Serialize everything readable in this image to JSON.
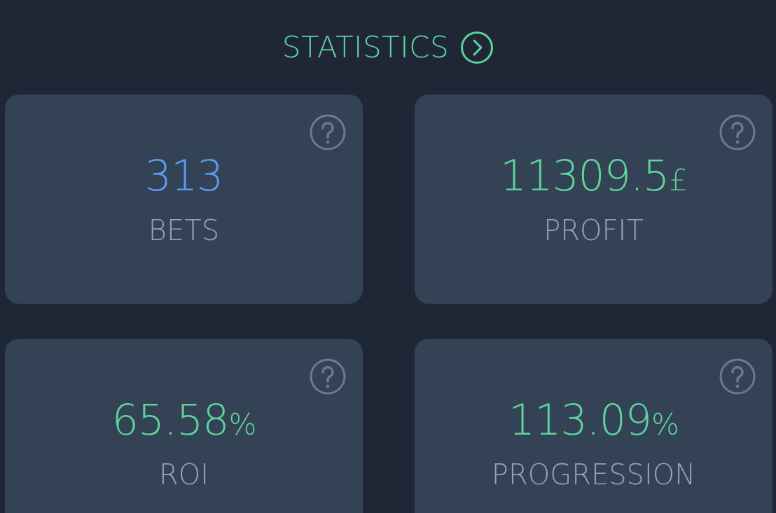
{
  "header": {
    "title": "STATISTICS"
  },
  "cards": [
    {
      "value": "313",
      "label": "BETS",
      "color": "#5a9cf0"
    },
    {
      "value": "11309.5",
      "unit": "£",
      "label": "PROFIT",
      "color": "#5fd39b"
    },
    {
      "value": "65.58",
      "unit": "%",
      "label": "ROI",
      "color": "#5fd39b"
    },
    {
      "value": "113.09",
      "unit": "%",
      "label": "PROGRESSION",
      "color": "#5fd39b"
    }
  ]
}
